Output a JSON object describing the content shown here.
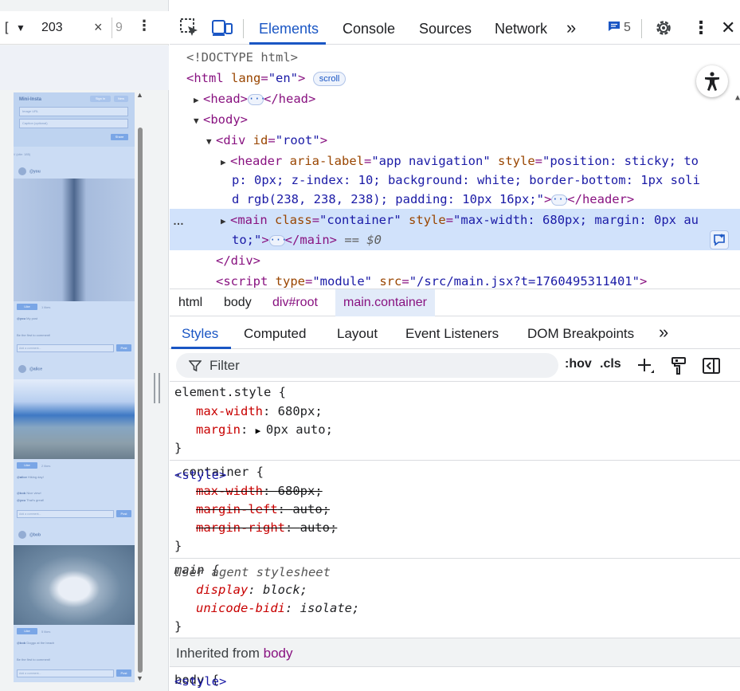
{
  "device_toolbar": {
    "width_value": "203",
    "height_value": "9",
    "times": "×",
    "more": "⋮",
    "bracket": "[",
    "caret": "▼"
  },
  "preview_app": {
    "title": "Mini-Insta",
    "header_buttons": [
      "Sign in",
      "New"
    ],
    "image_url_placeholder": "Image URL",
    "caption_placeholder": "Caption (optional)",
    "share_label": "Share",
    "debug_note": "// (cite: 185)",
    "posts": [
      {
        "user": "@you",
        "likes": "1 likes",
        "caption_user": "@you",
        "caption": "My post",
        "comments": [],
        "empty_comments": "Be the first to comment!",
        "comment_placeholder": "Add a comment...",
        "post_label": "Post"
      },
      {
        "user": "@alice",
        "likes": "2 likes",
        "caption_user": "@alice",
        "caption": "Hiking day!",
        "comments": [
          {
            "user": "@bob",
            "text": "Nice view!"
          },
          {
            "user": "@you",
            "text": "That's great!"
          }
        ],
        "empty_comments": "",
        "comment_placeholder": "Add a comment...",
        "post_label": "Post"
      },
      {
        "user": "@bob",
        "likes": "5 likes",
        "caption_user": "@bob",
        "caption": "Doggo at the beach",
        "comments": [],
        "empty_comments": "Be the first to comment!",
        "comment_placeholder": "Add a comment...",
        "post_label": "Post"
      }
    ],
    "like_label": "Like"
  },
  "devtools": {
    "tabs": [
      "Elements",
      "Console",
      "Sources",
      "Network"
    ],
    "more_tabs": "»",
    "issues_count": "5",
    "elements": {
      "doctype": "<!DOCTYPE html>",
      "html_open": "<html",
      "html_attr": "lang",
      "html_attr_val": "\"en\"",
      "html_close": ">",
      "scroll_badge": "scroll",
      "head": "<head>",
      "head_end": "</head>",
      "body": "<body>",
      "div_open": "<div",
      "div_attr": "id",
      "div_val": "\"root\"",
      "div_close": ">",
      "header_open": "<header",
      "header_attr1": "aria-label",
      "header_val1": "\"app navigation\"",
      "header_attr2": "style",
      "header_val2_l1": "\"position: sticky; to",
      "header_val2_l2": "p: 0px; z-index: 10; background: white; border-bottom: 1px soli",
      "header_val2_l3": "d rgb(238, 238, 238); padding: 10px 16px;\"",
      "header_end": "</header>",
      "main_open": "<main",
      "main_attr1": "class",
      "main_val1": "\"container\"",
      "main_attr2": "style",
      "main_val2_l1": "\"max-width: 680px; margin: 0px au",
      "main_val2_l2": "to;\"",
      "main_end": "</main>",
      "main_marker": "== $0",
      "div_end": "</div>",
      "script_open": "<script",
      "script_attr1": "type",
      "script_val1": "\"module\"",
      "script_attr2": "src",
      "script_val2": "\"/src/main.jsx?t=1760495311401\"",
      "script_close": ">",
      "ellipsis": "…"
    },
    "breadcrumbs": [
      "html",
      "body",
      "div#root",
      "main.container"
    ],
    "sub_tabs": [
      "Styles",
      "Computed",
      "Layout",
      "Event Listeners",
      "DOM Breakpoints"
    ],
    "sub_more": "»",
    "filter_placeholder": "Filter",
    "hov": ":hov",
    "cls": ".cls",
    "rules": {
      "element_style": {
        "selector": "element.style {",
        "props": [
          {
            "name": "max-width",
            "value": "680px;"
          },
          {
            "name": "margin",
            "value": "0px auto;"
          }
        ]
      },
      "container": {
        "selector": ".container {",
        "source": "<style>",
        "props": [
          {
            "name": "max-width",
            "value": "680px;"
          },
          {
            "name": "margin-left",
            "value": "auto;"
          },
          {
            "name": "margin-right",
            "value": "auto;"
          }
        ]
      },
      "main_ua": {
        "selector": "main {",
        "source": "user agent stylesheet",
        "props": [
          {
            "name": "display",
            "value": "block;"
          },
          {
            "name": "unicode-bidi",
            "value": "isolate;"
          }
        ]
      },
      "close_brace": "}",
      "inherited_label": "Inherited from",
      "inherited_tag": "body",
      "body_selector": "body {",
      "body_source": "<style>"
    }
  },
  "colors": {
    "accent": "#1a56c4",
    "selected_row": "#d1e2fb",
    "tag": "#881280",
    "attr": "#994500",
    "value": "#1a1aa6",
    "prop": "#c80000"
  }
}
